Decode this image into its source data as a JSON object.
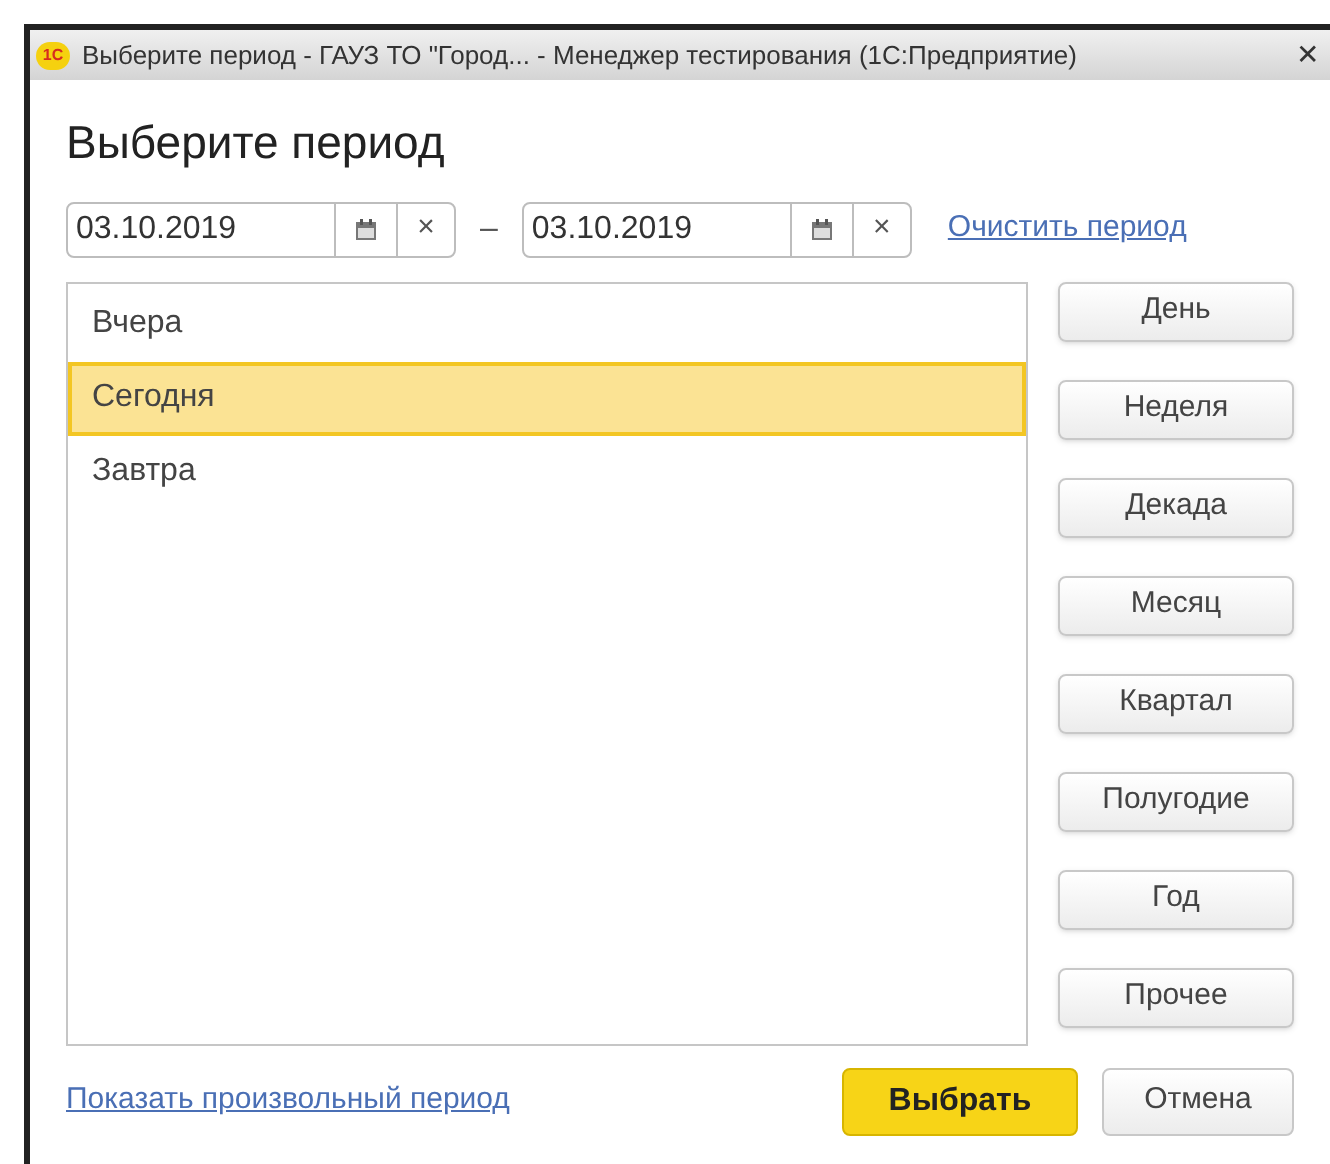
{
  "window": {
    "title": "Выберите период - ГАУЗ ТО \"Город... - Менеджер тестирования (1С:Предприятие)",
    "logo": "1С",
    "close": "✕"
  },
  "heading": "Выберите период",
  "date_from": {
    "value": "03.10.2019",
    "clear": "×"
  },
  "separator": "–",
  "date_to": {
    "value": "03.10.2019",
    "clear": "×"
  },
  "clear_link": "Очистить период",
  "periods": [
    {
      "label": "Вчера",
      "selected": false
    },
    {
      "label": "Сегодня",
      "selected": true
    },
    {
      "label": "Завтра",
      "selected": false
    }
  ],
  "period_buttons": [
    "День",
    "Неделя",
    "Декада",
    "Месяц",
    "Квартал",
    "Полугодие",
    "Год",
    "Прочее"
  ],
  "custom_link": "Показать произвольный период",
  "buttons": [
    {
      "label": "Выбрать",
      "kind": "primary"
    },
    {
      "label": "Отмена",
      "kind": "default"
    }
  ]
}
